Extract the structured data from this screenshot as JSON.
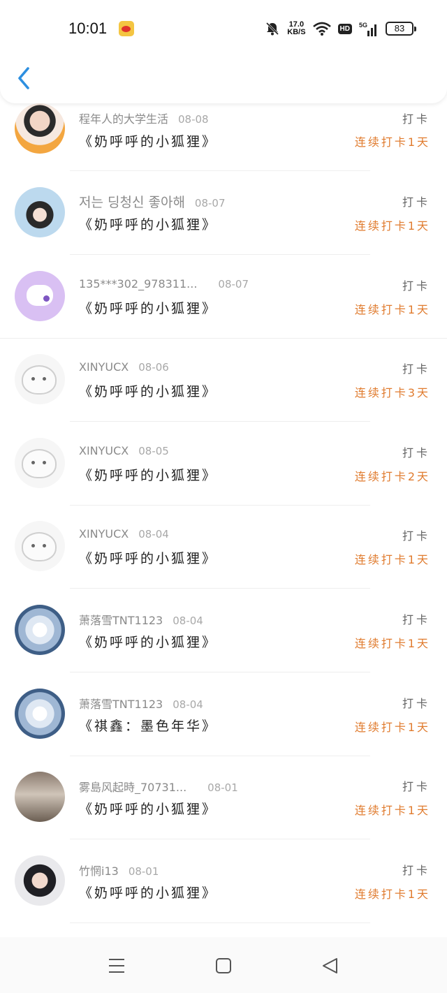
{
  "status_bar": {
    "time": "10:01",
    "net_speed_value": "17.0",
    "net_speed_unit": "KB/S",
    "hd_label": "HD",
    "signal_label": "5G",
    "battery": "83"
  },
  "header": {
    "back_icon": "chevron-left-icon"
  },
  "entries": [
    {
      "name": "程年人的大学生活",
      "date": "08-08",
      "book": "《奶呼呼的小狐狸》",
      "action": "打卡",
      "streak": "连续打卡1天"
    },
    {
      "name": "저는 딩청신 좋아해",
      "date": "08-07",
      "book": "《奶呼呼的小狐狸》",
      "action": "打卡",
      "streak": "连续打卡1天"
    },
    {
      "name": "135***302_978311...",
      "date": "08-07",
      "book": "《奶呼呼的小狐狸》",
      "action": "打卡",
      "streak": "连续打卡1天"
    },
    {
      "name": "XINYUCX",
      "date": "08-06",
      "book": "《奶呼呼的小狐狸》",
      "action": "打卡",
      "streak": "连续打卡3天"
    },
    {
      "name": "XINYUCX",
      "date": "08-05",
      "book": "《奶呼呼的小狐狸》",
      "action": "打卡",
      "streak": "连续打卡2天"
    },
    {
      "name": "XINYUCX",
      "date": "08-04",
      "book": "《奶呼呼的小狐狸》",
      "action": "打卡",
      "streak": "连续打卡1天"
    },
    {
      "name": "萧落雪TNT1123",
      "date": "08-04",
      "book": "《奶呼呼的小狐狸》",
      "action": "打卡",
      "streak": "连续打卡1天"
    },
    {
      "name": "萧落雪TNT1123",
      "date": "08-04",
      "book": "《祺鑫：墨色年华》",
      "action": "打卡",
      "streak": "连续打卡1天"
    },
    {
      "name": "雾島风起時_70731...",
      "date": "08-01",
      "book": "《奶呼呼的小狐狸》",
      "action": "打卡",
      "streak": "连续打卡1天"
    },
    {
      "name": "竹惘i13",
      "date": "08-01",
      "book": "《奶呼呼的小狐狸》",
      "action": "打卡",
      "streak": "连续打卡1天"
    }
  ],
  "nav_bar": {
    "menu_icon": "menu-icon",
    "home_icon": "home-square-icon",
    "back_icon": "back-triangle-icon"
  },
  "colors": {
    "accent": "#e07b2e",
    "back_arrow": "#2d8fe0",
    "avatar_purple": "#d9c0f3"
  }
}
